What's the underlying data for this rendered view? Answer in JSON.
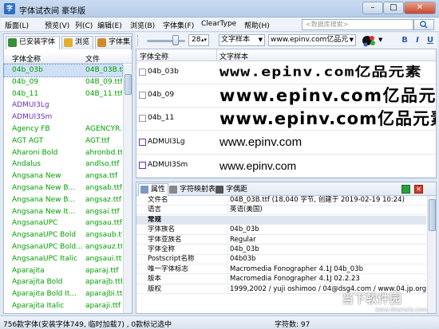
{
  "window": {
    "title": "字体试衣间 豪华版",
    "min": "–",
    "max": "□",
    "close": "✕",
    "app_icon": "字"
  },
  "menu": {
    "items": [
      "版面(L)",
      "预览(V)",
      "列(C)",
      "编辑(E)",
      "浏览(B)",
      "字体集(F)",
      "ClearType",
      "帮助(H)"
    ],
    "search_placeholder": "<数据库搜索>"
  },
  "left_tabs": [
    "已安装字体",
    "浏览",
    "字体集"
  ],
  "left_header": {
    "name": "字体全称",
    "file": "文件"
  },
  "font_list": [
    {
      "name": "04b_03b",
      "file": "04B_03B.ttf",
      "color": "#00a000",
      "selected": true
    },
    {
      "name": "04b_09",
      "file": "04B_09.ttf",
      "color": "#00a000"
    },
    {
      "name": "04b_11",
      "file": "04B_11.ttf",
      "color": "#00a000"
    },
    {
      "name": "ADMUI3Lg",
      "file": "",
      "color": "#6a2fb5"
    },
    {
      "name": "ADMUI3Sm",
      "file": "",
      "color": "#6a2fb5"
    },
    {
      "name": "Agency FB",
      "file": "AGENCYR.TTF",
      "color": "#00a000"
    },
    {
      "name": "AGT AGT",
      "file": "AGT.ttf",
      "color": "#00a000"
    },
    {
      "name": "Aharoni Bold",
      "file": "ahronbd.ttf",
      "color": "#00a000"
    },
    {
      "name": "Andalus",
      "file": "andlso.ttf",
      "color": "#00a000"
    },
    {
      "name": "Angsana New",
      "file": "angsa.ttf",
      "color": "#00a000"
    },
    {
      "name": "Angsana New B...",
      "file": "angsab.ttf",
      "color": "#00a000"
    },
    {
      "name": "Angsana New B...",
      "file": "angsaz.ttf",
      "color": "#00a000"
    },
    {
      "name": "Angsana New It...",
      "file": "angsai.ttf",
      "color": "#00a000"
    },
    {
      "name": "AngsanaUPC",
      "file": "angsau.ttf",
      "color": "#00a000"
    },
    {
      "name": "AngsanaUPC Bold",
      "file": "angsaub.ttf",
      "color": "#00a000"
    },
    {
      "name": "AngsanaUPC Bold...",
      "file": "angsauz.ttf",
      "color": "#00a000"
    },
    {
      "name": "AngsanaUPC Italic",
      "file": "angsaui.ttf",
      "color": "#00a000"
    },
    {
      "name": "Aparajita",
      "file": "aparaj.ttf",
      "color": "#00a000"
    },
    {
      "name": "Aparajita Bold",
      "file": "aparajb.ttf",
      "color": "#00a000"
    },
    {
      "name": "Aparajita Bold It...",
      "file": "aparajbi.ttf",
      "color": "#00a000"
    },
    {
      "name": "Aparajita Italic",
      "file": "aparaji.ttf",
      "color": "#00a000"
    }
  ],
  "toolbar": {
    "size": "28",
    "sample_type": "文字样本",
    "sample_text": "www.epinv.com亿品元素",
    "bold": "B",
    "italic": "I",
    "underline": "U"
  },
  "preview_header": {
    "name": "字体全称",
    "sample": "文字样本"
  },
  "preview_rows": [
    {
      "name": "04b_03b",
      "sample": "www.epinv.com亿品元素",
      "style": "pixel-a"
    },
    {
      "name": "04b_09",
      "sample": "www.epinv.com亿品元素",
      "style": "pixel-b"
    },
    {
      "name": "04b_11",
      "sample": "www.epinv.com亿品元素",
      "style": "pixel-c"
    },
    {
      "name": "ADMUI3Lg",
      "sample": "www.epinv.com",
      "style": "plain"
    },
    {
      "name": "ADMUI3Sm",
      "sample": "www.epinv.com",
      "style": "plain-sm"
    }
  ],
  "prop_tabs": [
    "属性",
    "字符映射表",
    "字偶距"
  ],
  "properties": [
    {
      "k": "文件名",
      "v": "04B_03B.ttf (18,040 字节, 创建于 2019-02-19  10:24)"
    },
    {
      "k": "语言",
      "v": "英语(美国)"
    },
    {
      "k": "常规",
      "v": "",
      "section": true
    },
    {
      "k": "字体族名",
      "v": "04b_03b"
    },
    {
      "k": "字体亚族名",
      "v": "Regular"
    },
    {
      "k": "字体全称",
      "v": "04b_03b"
    },
    {
      "k": "Postscript名称",
      "v": "04b03b"
    },
    {
      "k": "唯一字体标志",
      "v": "Macromedia Fonographer 4.1J 04b_03b"
    },
    {
      "k": "版本",
      "v": "Macromedia Fonographer 4.1J 02.2.23"
    },
    {
      "k": "版权",
      "v": "1999,2002 / yuji oshimoo / 04@dsg4.com / www.04.jp.org"
    }
  ],
  "status": {
    "left": "756款字体(安装字体749, 临时加载7) , 0款标记选中",
    "chars": "字符数: 97"
  },
  "watermark": {
    "title": "当下软件园",
    "sub": "www.downxia.com"
  },
  "colors": {
    "installed": "#00a000",
    "system": "#6a2fb5",
    "accent": "#2a5ea7"
  }
}
